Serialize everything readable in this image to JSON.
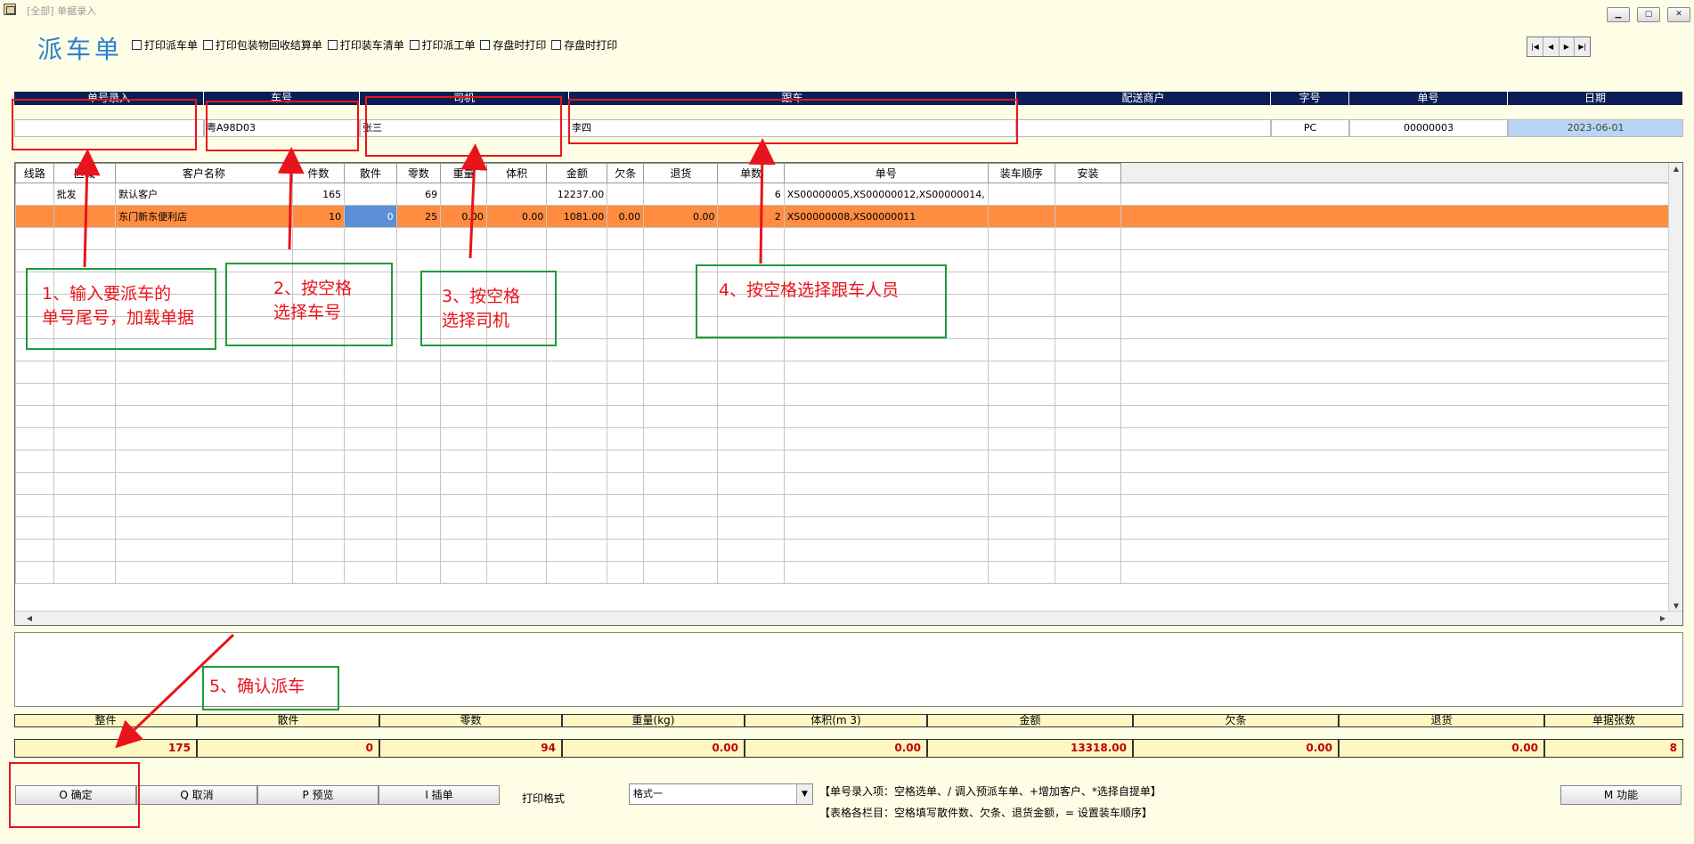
{
  "window": {
    "title": "[全部] 单据录入",
    "min_icon": "minimize-icon",
    "max_icon": "maximize-icon",
    "close_icon": "close-icon"
  },
  "header": {
    "title": "派车单",
    "checkboxes": [
      "打印派车单",
      "打印包装物回收结算单",
      "打印装车清单",
      "打印派工单",
      "存盘时打印",
      "存盘时打印"
    ],
    "nav": [
      "first-icon",
      "prev-icon",
      "next-icon",
      "last-icon"
    ]
  },
  "fields": {
    "labels": [
      "单号录入",
      "车号",
      "司机",
      "跟车",
      "配送商户",
      "字号",
      "单号",
      "日期"
    ],
    "order_input": "",
    "car_no": "粤A98D03",
    "driver": "张三",
    "escort": "李四",
    "merchant": "",
    "prefix": "PC",
    "doc_no": "00000003",
    "date": "2023-06-01"
  },
  "grid": {
    "columns": [
      "线路",
      "区域",
      "客户名称",
      "件数",
      "散件",
      "零数",
      "重量",
      "体积",
      "金额",
      "欠条",
      "退货",
      "单数",
      "单号",
      "装车顺序",
      "安装"
    ],
    "rows": [
      [
        "",
        "批发",
        "默认客户",
        "165",
        "",
        "69",
        "",
        "",
        "12237.00",
        "",
        "",
        "6",
        "XS00000005,XS00000012,XS00000014,",
        "",
        ""
      ],
      [
        "",
        "",
        "东门新东便利店",
        "10",
        "0",
        "25",
        "0.00",
        "0.00",
        "1081.00",
        "0.00",
        "0.00",
        "2",
        "XS00000008,XS00000011",
        "",
        ""
      ]
    ]
  },
  "totals": {
    "labels": [
      "整件",
      "散件",
      "零数",
      "重量(kg)",
      "体积(m 3)",
      "金额",
      "欠条",
      "退货",
      "单据张数"
    ],
    "values": [
      "175",
      "0",
      "94",
      "0.00",
      "0.00",
      "13318.00",
      "0.00",
      "0.00",
      "8"
    ]
  },
  "buttons": {
    "ok": "O 确定",
    "cancel": "Q 取消",
    "preview": "P 预览",
    "insert": "I 插单",
    "func": "M 功能"
  },
  "print": {
    "label": "打印格式",
    "selected": "格式一"
  },
  "hints": [
    "【单号录入项：空格选单、/ 调入预派车单、+增加客户、*选择自提单】",
    "【表格各栏目：空格填写散件数、欠条、退货金额，= 设置装车顺序】"
  ],
  "annotations": {
    "step1": [
      "1、输入要派车的",
      "单号尾号，加载单据"
    ],
    "step2": [
      "2、按空格",
      "选择车号"
    ],
    "step3": [
      "3、按空格",
      "选择司机"
    ],
    "step4": [
      "4、按空格选择跟车人员"
    ],
    "step5": [
      "5、确认派车"
    ]
  }
}
